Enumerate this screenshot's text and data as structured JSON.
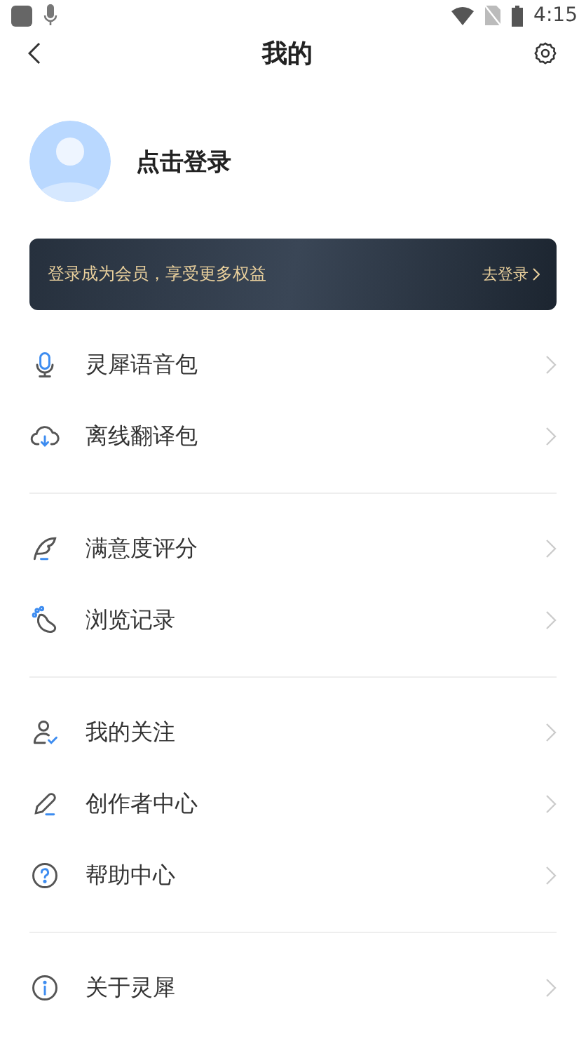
{
  "status_bar": {
    "time": "4:15"
  },
  "header": {
    "title": "我的"
  },
  "profile": {
    "name": "点击登录"
  },
  "banner": {
    "text": "登录成为会员，享受更多权益",
    "action": "去登录"
  },
  "sections": [
    {
      "items": [
        {
          "kind": "mic",
          "label": "灵犀语音包"
        },
        {
          "kind": "cloud",
          "label": "离线翻译包"
        }
      ]
    },
    {
      "items": [
        {
          "kind": "feather",
          "label": "满意度评分"
        },
        {
          "kind": "footprint",
          "label": "浏览记录"
        }
      ]
    },
    {
      "items": [
        {
          "kind": "follow",
          "label": "我的关注"
        },
        {
          "kind": "pen",
          "label": "创作者中心"
        },
        {
          "kind": "help",
          "label": "帮助中心"
        }
      ]
    },
    {
      "items": [
        {
          "kind": "info",
          "label": "关于灵犀"
        }
      ]
    }
  ]
}
